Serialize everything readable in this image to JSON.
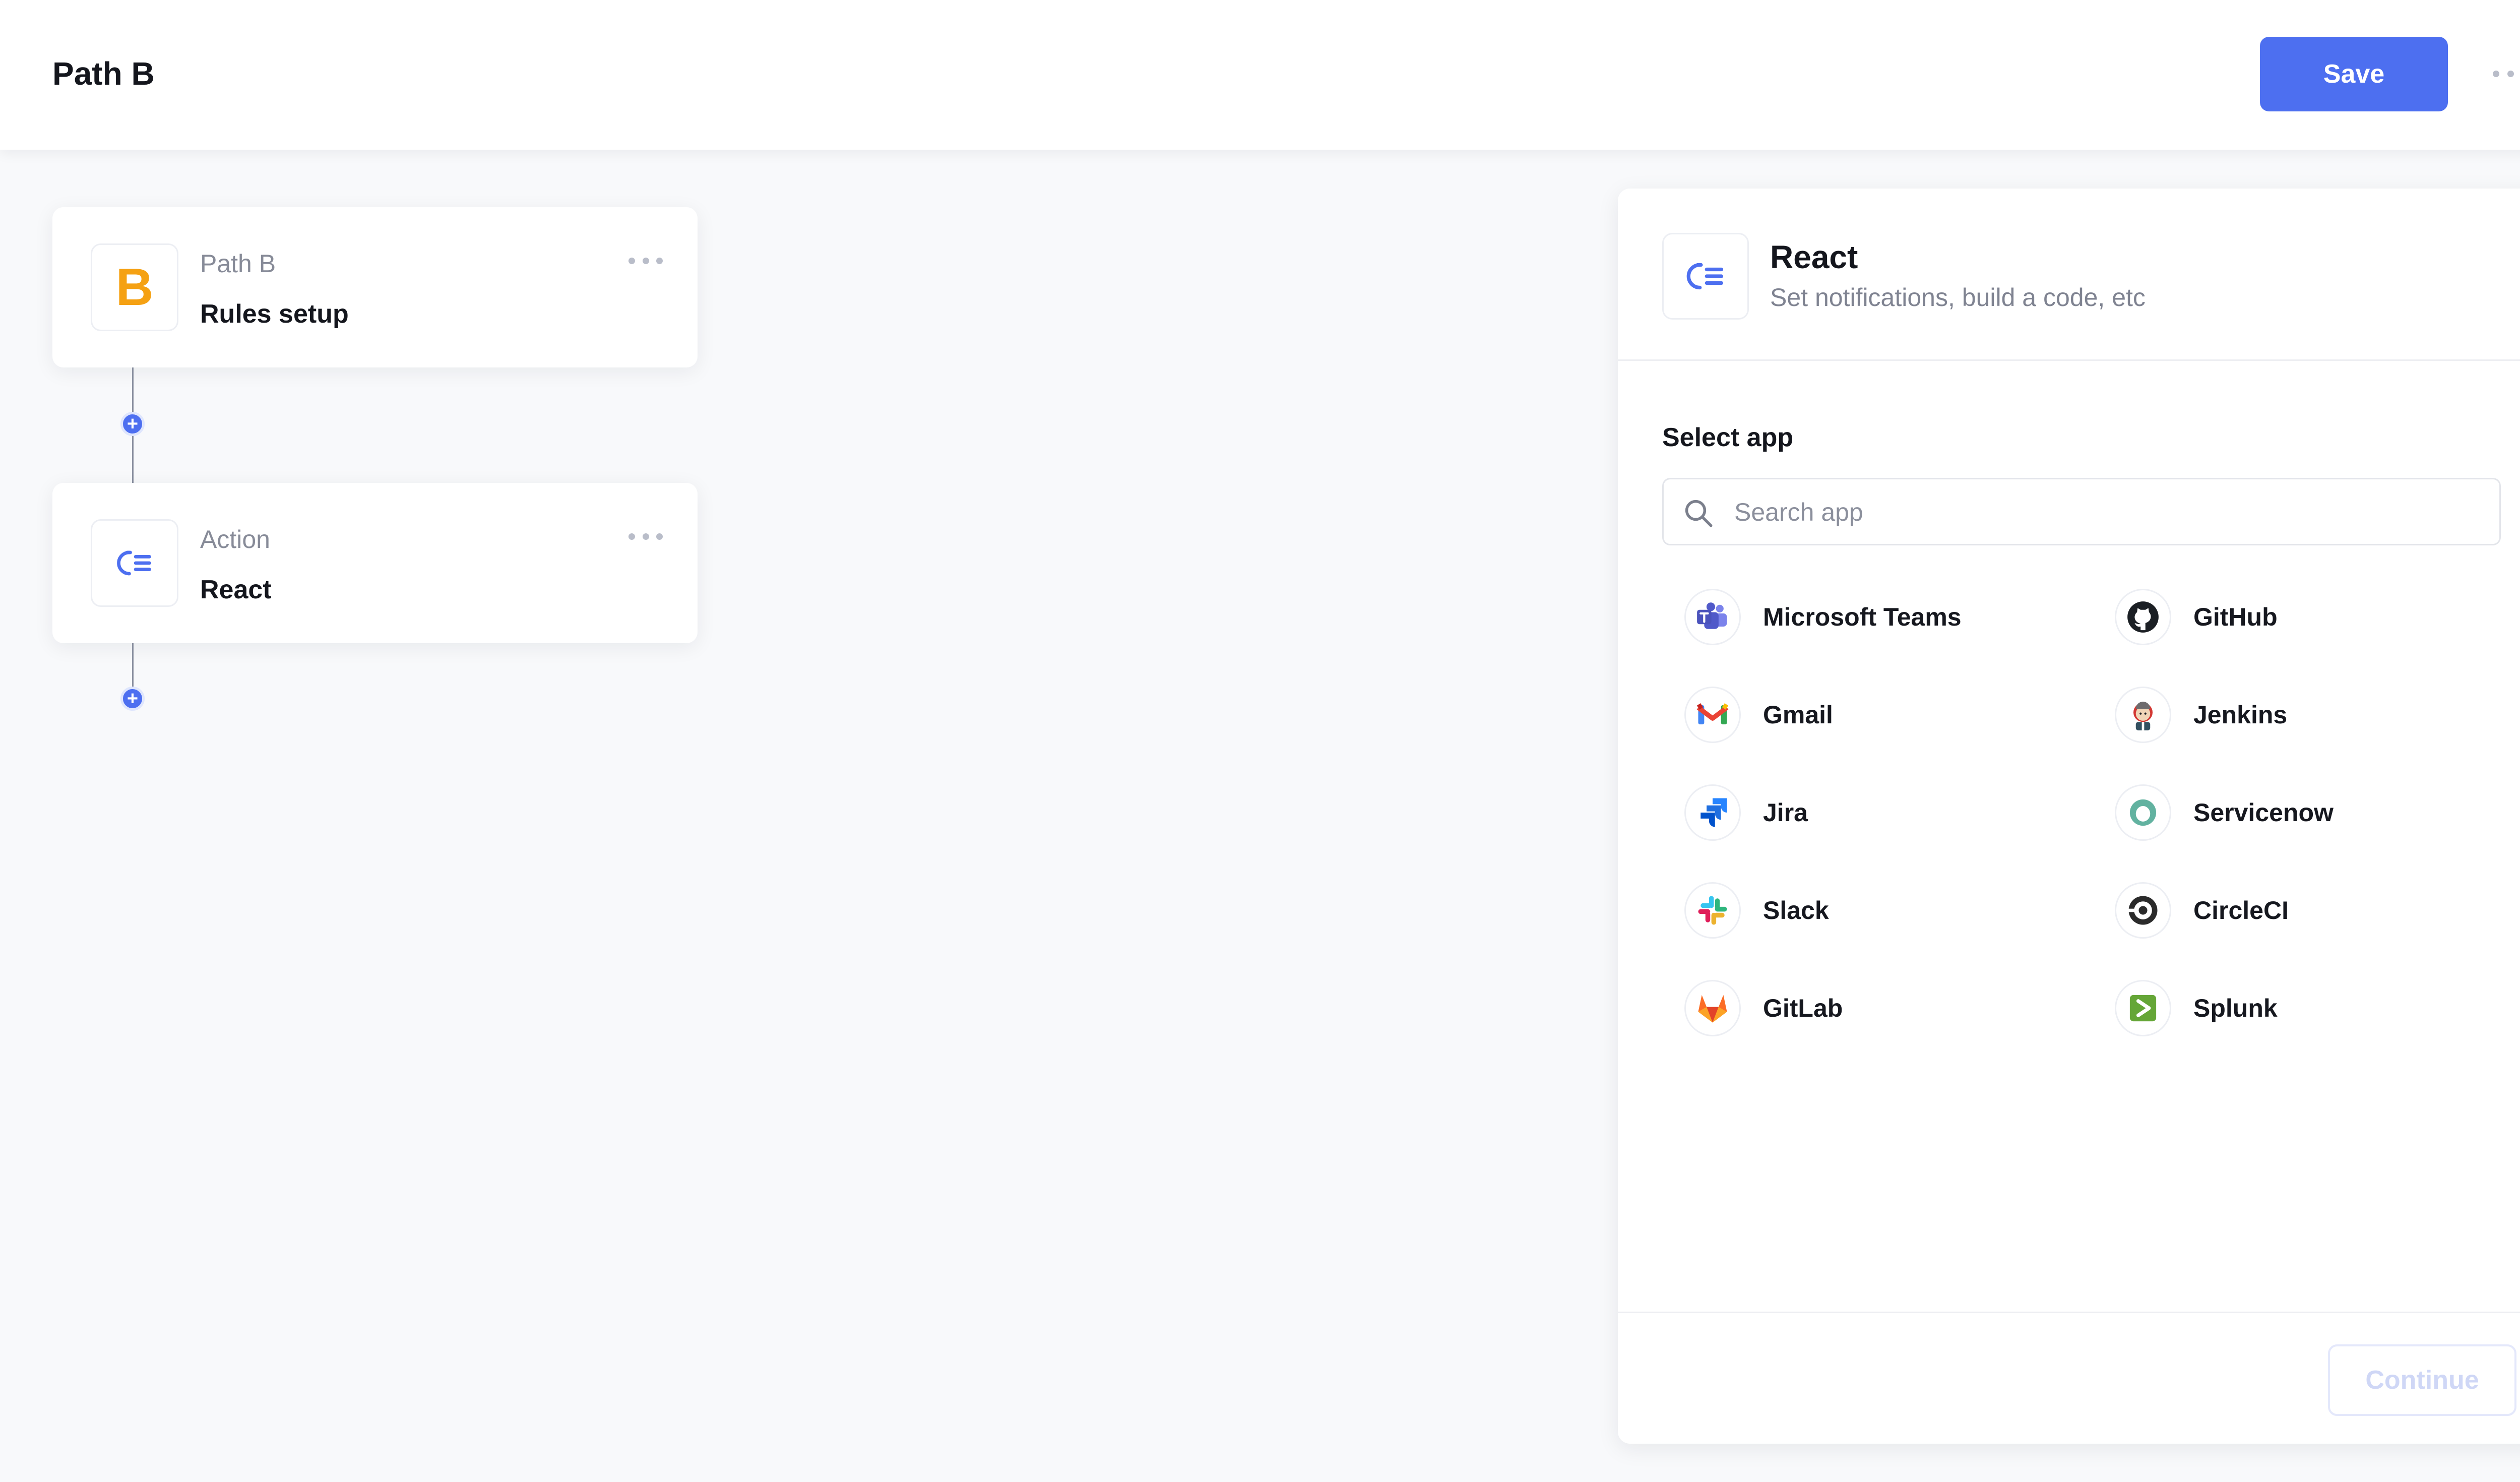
{
  "header": {
    "title": "Path B",
    "save_label": "Save",
    "more_icon": "more-horizontal-icon"
  },
  "flow": {
    "path_card": {
      "kicker": "Path B",
      "heading": "Rules setup",
      "icon_letter": "B",
      "icon_color": "#f5a113"
    },
    "action_card": {
      "kicker": "Action",
      "heading": "React",
      "icon": "react-action-icon"
    },
    "add_step_icon": "plus-circle-icon"
  },
  "panel": {
    "title": "React",
    "subtitle": "Set notifications, build a code, etc",
    "section_label": "Select app",
    "search_placeholder": "Search app",
    "search_value": "",
    "apps": [
      {
        "name": "Microsoft Teams",
        "icon": "microsoft-teams-icon"
      },
      {
        "name": "GitHub",
        "icon": "github-icon"
      },
      {
        "name": "Gmail",
        "icon": "gmail-icon"
      },
      {
        "name": "Jenkins",
        "icon": "jenkins-icon"
      },
      {
        "name": "Jira",
        "icon": "jira-icon"
      },
      {
        "name": "Servicenow",
        "icon": "servicenow-icon"
      },
      {
        "name": "Slack",
        "icon": "slack-icon"
      },
      {
        "name": "CircleCI",
        "icon": "circleci-icon"
      },
      {
        "name": "GitLab",
        "icon": "gitlab-icon"
      },
      {
        "name": "Splunk",
        "icon": "splunk-icon"
      }
    ],
    "continue_label": "Continue"
  },
  "colors": {
    "accent": "#4d6ff0",
    "background": "#f8f9fb",
    "card": "#ffffff",
    "path_letter": "#f5a113"
  }
}
